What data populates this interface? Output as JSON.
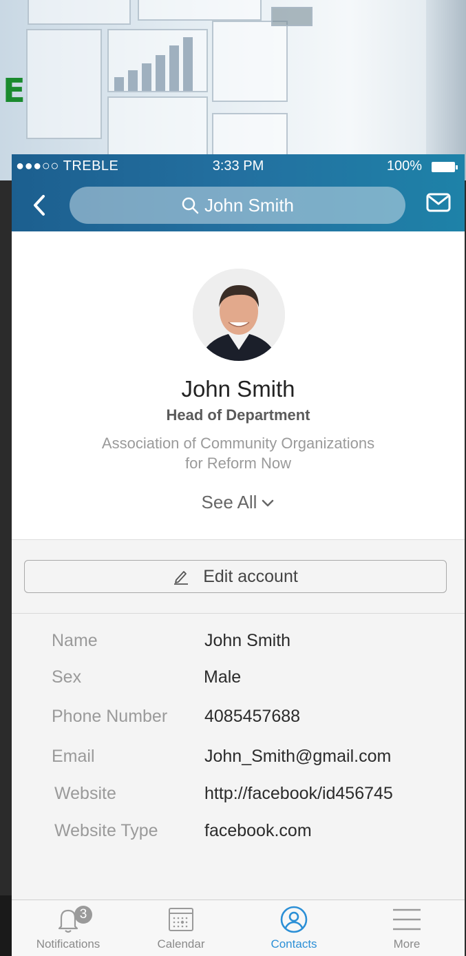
{
  "status_bar": {
    "carrier": "●●●○○ TREBLE",
    "time": "3:33 PM",
    "battery": "100%"
  },
  "nav": {
    "search_text": "John Smith",
    "back_icon": "chevron-left-icon",
    "mail_icon": "mail-icon"
  },
  "banner": {
    "letter": "E"
  },
  "profile": {
    "name": "John Smith",
    "title": "Head of Department",
    "organization_line1": "Association of  Community Organizations",
    "organization_line2": "for Reform Now",
    "see_all": "See All"
  },
  "edit_button": {
    "label": "Edit account",
    "icon": "pencil-icon"
  },
  "details": [
    {
      "label": "Name",
      "value": "John Smith"
    },
    {
      "label": "Sex",
      "value": "Male"
    },
    {
      "label": "Phone Number",
      "value": "4085457688"
    },
    {
      "label": "Email",
      "value": "John_Smith@gmail.com"
    },
    {
      "label": "Website",
      "value": "http://facebook/id456745"
    },
    {
      "label": "Website Type",
      "value": "facebook.com"
    }
  ],
  "tabbar": {
    "tabs": [
      {
        "label": "Notifications",
        "icon": "bell-icon",
        "badge": "3"
      },
      {
        "label": "Calendar",
        "icon": "calendar-icon"
      },
      {
        "label": "Contacts",
        "icon": "contacts-icon",
        "active": true
      },
      {
        "label": "More",
        "icon": "menu-icon"
      }
    ]
  },
  "colors": {
    "nav_start": "#1c5f8f",
    "nav_end": "#1e82a8",
    "active_tab": "#2b8fd6",
    "banner_letter": "#1a8a2e"
  }
}
